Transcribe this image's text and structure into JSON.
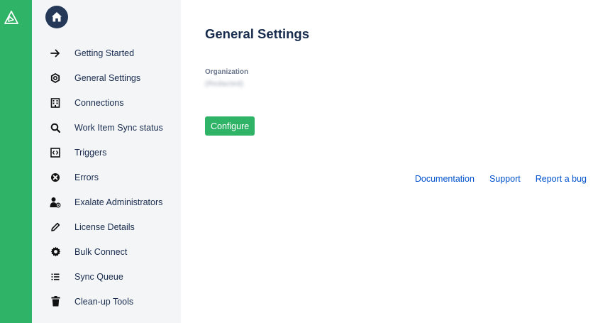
{
  "app": {
    "logo_icon": "exalate-logo-icon",
    "accent_color": "#2fb366"
  },
  "sidebar": {
    "home_icon": "home-icon",
    "items": [
      {
        "label": "Getting Started",
        "icon": "arrow-right-icon"
      },
      {
        "label": "General Settings",
        "icon": "hexagon-nut-icon"
      },
      {
        "label": "Connections",
        "icon": "building-icon"
      },
      {
        "label": "Work Item Sync status",
        "icon": "search-icon"
      },
      {
        "label": "Triggers",
        "icon": "code-box-icon"
      },
      {
        "label": "Errors",
        "icon": "error-circle-icon"
      },
      {
        "label": "Exalate Administrators",
        "icon": "user-admin-icon"
      },
      {
        "label": "License Details",
        "icon": "pencil-icon"
      },
      {
        "label": "Bulk Connect",
        "icon": "gear-icon"
      },
      {
        "label": "Sync Queue",
        "icon": "list-icon"
      },
      {
        "label": "Clean-up Tools",
        "icon": "trash-icon"
      }
    ]
  },
  "main": {
    "title": "General Settings",
    "organization_label": "Organization",
    "organization_value": "(Redacted)",
    "configure_label": "Configure"
  },
  "footer": {
    "links": [
      "Documentation",
      "Support",
      "Report a bug"
    ]
  }
}
